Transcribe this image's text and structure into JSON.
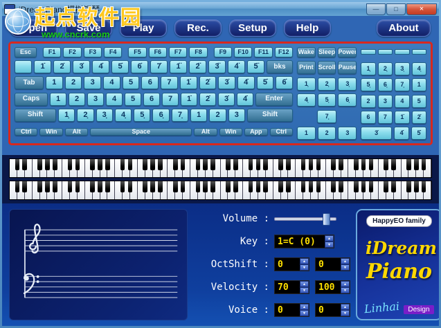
{
  "window": {
    "title": "iDreamPiano模拟钢琴",
    "minimize": "—",
    "maximize": "□",
    "close": "×"
  },
  "watermark": {
    "site": "起点软件园",
    "url": "www.cncrk.com"
  },
  "menu": {
    "items": [
      "Open",
      "Save",
      "Play",
      "Rec.",
      "Setup",
      "Help",
      "About"
    ]
  },
  "keyboard": {
    "fn_row": {
      "esc": "Esc",
      "group1": [
        "F1",
        "F2",
        "F3",
        "F4"
      ],
      "group2": [
        "F5",
        "F6",
        "F7",
        "F8"
      ],
      "group3": [
        "F9",
        "F10",
        "F11",
        "F12"
      ]
    },
    "num_row": {
      "keys": [
        "",
        "1̇",
        "2̇",
        "3̇",
        "4̇",
        "5̇",
        "6̇",
        "7̇",
        "1̈",
        "2̈",
        "3̈",
        "4̈",
        "5̈"
      ],
      "backspace": "bks"
    },
    "tab_row": {
      "mod": "Tab",
      "keys": [
        "1",
        "2",
        "3",
        "4",
        "5",
        "6",
        "7",
        "1̇",
        "2̇",
        "3̇",
        "4̇",
        "5̇",
        "6̇"
      ]
    },
    "caps_row": {
      "mod": "Caps",
      "keys": [
        "1",
        "2",
        "3",
        "4",
        "5",
        "6",
        "7",
        "1̇",
        "2̇",
        "3̇",
        "4̇"
      ],
      "enter": "Enter"
    },
    "shift_row": {
      "mod_left": "Shift",
      "keys": [
        "1̣",
        "2̣",
        "3̣",
        "4̣",
        "5̣",
        "6̣",
        "7̣",
        "1",
        "2",
        "3"
      ],
      "mod_right": "Shift"
    },
    "ctrl_row": {
      "keys": [
        "Ctrl",
        "Win",
        "Alt",
        "Space",
        "Alt",
        "Win",
        "App",
        "Ctrl"
      ]
    },
    "mid": {
      "row1": [
        "Wake",
        "Sleep",
        "Power"
      ],
      "row2": [
        "Print",
        "Scroll",
        "Pause"
      ],
      "row3": [
        "1̣",
        "2̣",
        "3̣"
      ],
      "row4": [
        "4̣",
        "5̣",
        "6̣"
      ],
      "row5": [
        "7̣"
      ],
      "row6": [
        "1",
        "2",
        "3"
      ]
    },
    "numpad": {
      "row2": [
        "1̣",
        "2̣",
        "3̣",
        "4̣"
      ],
      "row3": [
        "5̣",
        "6̣",
        "7̣",
        "1"
      ],
      "row4": [
        "2",
        "3",
        "4",
        "5"
      ],
      "row5": [
        "6",
        "7",
        "1̇",
        "2̇"
      ],
      "row6": [
        "3̇",
        "4̇",
        "5̇"
      ]
    }
  },
  "piano": {
    "white_keys": 56,
    "strips": 2
  },
  "controls": {
    "volume": {
      "label": "Volume :",
      "value_percent": 85
    },
    "key": {
      "label": "Key :",
      "value": "1=C (0)"
    },
    "octshift": {
      "label": "OctShift :",
      "left": "0",
      "right": "0"
    },
    "velocity": {
      "label": "Velocity :",
      "left": "70",
      "right": "100"
    },
    "voice": {
      "label": "Voice :",
      "left": "0",
      "right": "0"
    }
  },
  "branding": {
    "family_button": "HappyEO family",
    "logo_line1": "iDream",
    "logo_line2": "Piano",
    "signature": "Linhai",
    "design_button": "Design"
  },
  "colors": {
    "accent_red": "#d8281e",
    "key_cyan": "#8adcec",
    "mod_blue": "#336f92",
    "value_yellow": "#ffe000"
  }
}
